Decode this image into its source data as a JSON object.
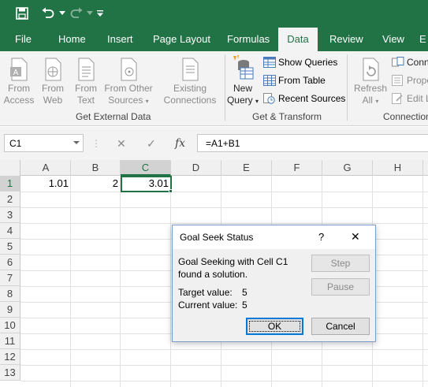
{
  "quick_access": {
    "save_icon": "save-icon",
    "undo_icon": "undo-icon",
    "redo_icon": "redo-icon",
    "customize_icon": "customize-arrow-icon"
  },
  "tabs": [
    "File",
    "Home",
    "Insert",
    "Page Layout",
    "Formulas",
    "Data",
    "Review",
    "View",
    "E"
  ],
  "active_tab": "Data",
  "ribbon": {
    "get_external_data": {
      "label": "Get External Data",
      "buttons": [
        {
          "line1": "From",
          "line2": "Access"
        },
        {
          "line1": "From",
          "line2": "Web"
        },
        {
          "line1": "From",
          "line2": "Text"
        },
        {
          "line1": "From Other",
          "line2": "Sources"
        },
        {
          "line1": "Existing",
          "line2": "Connections"
        }
      ]
    },
    "get_transform": {
      "label": "Get & Transform",
      "new_query": {
        "line1": "New",
        "line2": "Query"
      },
      "show_queries": "Show Queries",
      "from_table": "From Table",
      "recent_sources": "Recent Sources"
    },
    "connections": {
      "label": "Connection",
      "refresh_all": {
        "line1": "Refresh",
        "line2": "All"
      },
      "items": [
        "Conn",
        "Prope",
        "Edit L"
      ]
    }
  },
  "formula_bar": {
    "name_box": "C1",
    "cancel_icon": "✕",
    "enter_icon": "✓",
    "fx_label": "fx",
    "formula": "=A1+B1"
  },
  "sheet": {
    "columns": [
      "A",
      "B",
      "C",
      "D",
      "E",
      "F",
      "G",
      "H"
    ],
    "selected_column": "C",
    "rows": [
      "1",
      "2",
      "3",
      "4",
      "5",
      "6",
      "7",
      "8",
      "9",
      "10",
      "11",
      "12",
      "13"
    ],
    "selected_row": "1",
    "cells": {
      "A1": "1.01",
      "B1": "2",
      "C1": "3.01"
    }
  },
  "dialog": {
    "title": "Goal Seek Status",
    "help": "?",
    "close": "✕",
    "message_line1": "Goal Seeking with Cell C1",
    "message_line2": "found a solution.",
    "target_label": "Target value:",
    "target_value": "5",
    "current_label": "Current value:",
    "current_value": "5",
    "step_label": "Step",
    "pause_label": "Pause",
    "ok_label": "OK",
    "cancel_label": "Cancel"
  }
}
